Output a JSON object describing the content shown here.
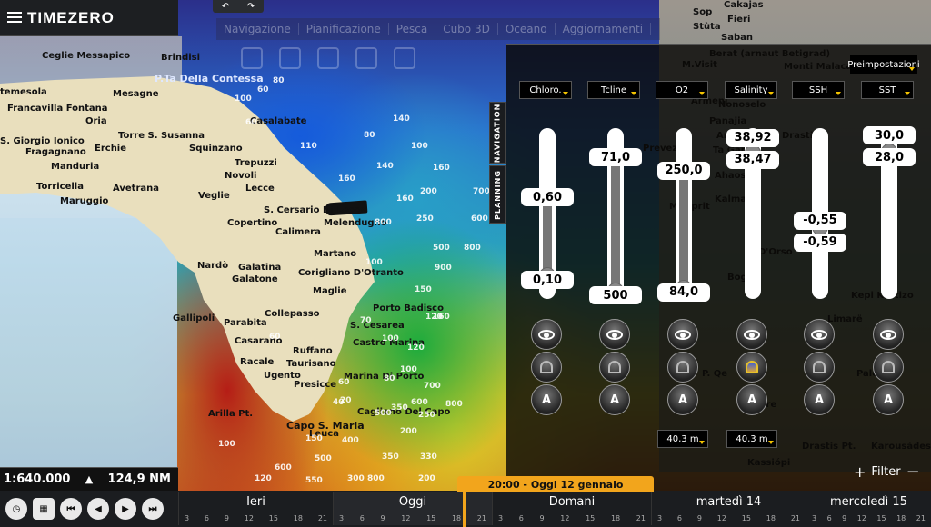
{
  "app": {
    "logo": "TIMEZERO"
  },
  "top": {
    "tabs": [
      "Navigazione",
      "Pianificazione",
      "Pesca",
      "Cubo 3D",
      "Oceano",
      "Aggiornamenti"
    ]
  },
  "side_tabs": {
    "navigation": "NAVIGATION",
    "planning": "PLANNING"
  },
  "map": {
    "labels": [
      "Ceglie Messapico",
      "Brindisi",
      "P.Ta Della Contessa",
      "temesola",
      "Mesagne",
      "Francavilla Fontana",
      "Oria",
      "Torre S. Susanna",
      "S. Giorgio Ionico",
      "Erchie",
      "Squinzano",
      "Fragagnano",
      "Manduria",
      "Trepuzzi",
      "Novoli",
      "Lecce",
      "Veglie",
      "Avetrana",
      "Torricella",
      "Maruggio",
      "S. Cersario Di Lecce",
      "Copertino",
      "Calimera",
      "Melendugno",
      "Martano",
      "Nardò",
      "Galatina",
      "Corigliano D'Otranto",
      "Galatone",
      "Maglie",
      "Gallipoli",
      "Parabita",
      "Collepasso",
      "Porto Badisco",
      "S. Cesarea",
      "Castro Marina",
      "Casarano",
      "Ruffano",
      "Racale",
      "Taurisano",
      "Ugento",
      "Marina Di Porto",
      "Presicce",
      "Cagliano Del Capo",
      "Capo S. Maria",
      "Leuca",
      "Casalabate",
      "Sop",
      "Stùta",
      "Cakajas",
      "Fieri",
      "Saban",
      "Berat (arnaut Betigrad)",
      "Monti Malacastra",
      "M.Visit",
      "Nonoselo",
      "Armeni",
      "Panajia",
      "Arta",
      "Drasti",
      "Prevez",
      "Ta Gardi",
      "Ahaos",
      "Kalmari",
      "M.Ciprit",
      "D'Orso",
      "Bogu",
      "Kepi Kortizo",
      "Limarë",
      "Palermo",
      "P. Qe",
      "Colore",
      "Drastis Pt.",
      "Karousádes",
      "Kassiópi",
      "Arilla Pt.",
      "Secche D'Ugento"
    ],
    "depths": [
      "60",
      "80",
      "100",
      "60",
      "110",
      "140",
      "80",
      "100",
      "140",
      "160",
      "160",
      "160",
      "200",
      "250",
      "500",
      "800",
      "600",
      "700",
      "800",
      "900",
      "100",
      "120",
      "160",
      "150",
      "120",
      "100",
      "80",
      "40",
      "60",
      "70",
      "100",
      "200",
      "350",
      "330",
      "250",
      "150",
      "400",
      "500",
      "600",
      "800",
      "700",
      "350",
      "300",
      "120",
      "500",
      "550",
      "600",
      "800",
      "200",
      "100",
      "60",
      "20"
    ]
  },
  "panel": {
    "presets_label": "Preimpostazioni",
    "columns": [
      {
        "name": "Chloro.",
        "top": "0,60",
        "bottom": "0,10",
        "upper": 0.6,
        "lower": 0.1,
        "vmin": 0.0,
        "vmax": 1.0,
        "active": false
      },
      {
        "name": "Tcline",
        "top": "71,0",
        "bottom": "500",
        "upper": 71.0,
        "lower": 500,
        "vmin": 0,
        "vmax": 500,
        "inverted": true,
        "active": false
      },
      {
        "name": "O2",
        "top": "250,0",
        "bottom": "84,0",
        "upper": 250.0,
        "lower": 84.0,
        "vmin": 80,
        "vmax": 300,
        "active": false,
        "depth": "40,3 m"
      },
      {
        "name": "Salinity",
        "top": "38,92",
        "bottom": "38,47",
        "upper": 38.92,
        "lower": 38.47,
        "vmin": 34,
        "vmax": 39,
        "active": true,
        "depth": "40,3 m"
      },
      {
        "name": "SSH",
        "top": "-0,55",
        "bottom": "-0,59",
        "upper": -0.55,
        "lower": -0.59,
        "vmin": -1.0,
        "vmax": 0.0,
        "active": false
      },
      {
        "name": "SST",
        "top": "30,0",
        "bottom": "28,0",
        "upper": 30.0,
        "lower": 28.0,
        "vmin": 10,
        "vmax": 30,
        "active": false
      }
    ],
    "filter_label": "Filter"
  },
  "scale": {
    "ratio": "1:640.000",
    "range": "124,9 NM"
  },
  "timeline": {
    "badge": "20:00 - Oggi 12 gennaio",
    "days": [
      "Ieri",
      "Oggi",
      "Domani",
      "martedì 14",
      "mercoledì 15"
    ],
    "hours": [
      "3",
      "6",
      "9",
      "12",
      "15",
      "18",
      "21"
    ]
  },
  "colors": {
    "accent": "#f2a51c",
    "dropdown_caret": "#f5c400",
    "panel_bg": "#0a0806"
  }
}
